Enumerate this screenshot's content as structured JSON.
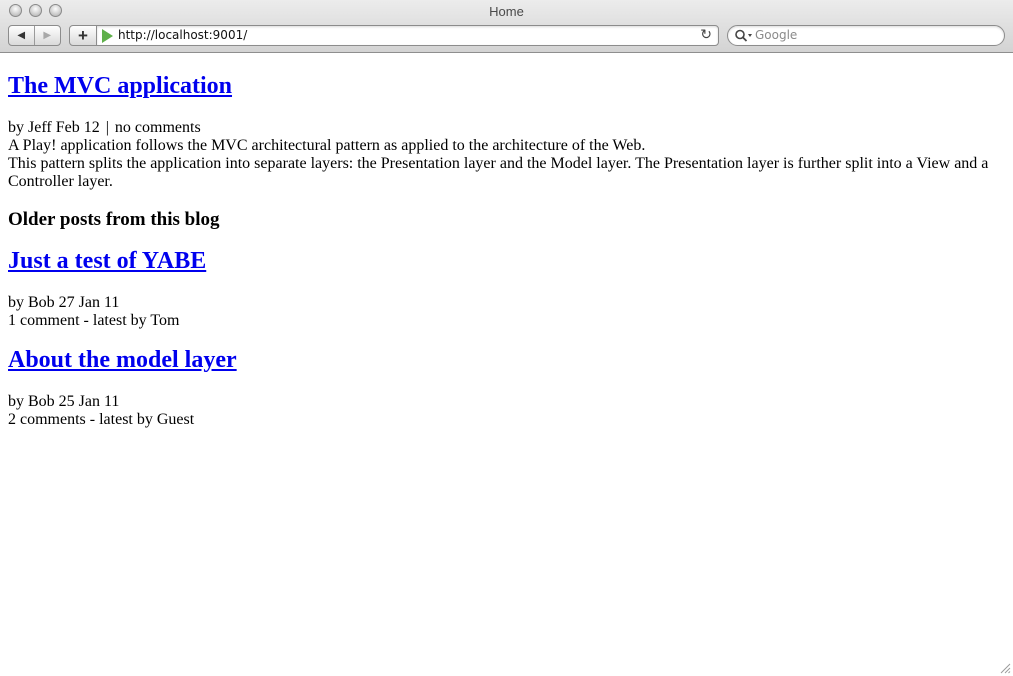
{
  "window": {
    "title": "Home"
  },
  "toolbar": {
    "add_label": "+",
    "url": "http://localhost:9001/",
    "search_placeholder": "Google"
  },
  "colors": {
    "link": "#0000ee",
    "play_icon": "#5fb04a"
  },
  "featured": {
    "title": "The MVC application",
    "meta": "by Jeff Feb 12",
    "separator": "|",
    "comments": "no comments",
    "body_line1": "A Play! application follows the MVC architectural pattern as applied to the architecture of the Web.",
    "body_line2": "This pattern splits the application into separate layers: the Presentation layer and the Model layer. The Presentation layer is further split into a View and a",
    "body_line3": "Controller layer."
  },
  "older": {
    "heading": "Older posts from this blog",
    "posts": [
      {
        "title": "Just a test of YABE",
        "meta": "by Bob 27 Jan 11",
        "comments": "1 comment - latest by Tom"
      },
      {
        "title": "About the model layer",
        "meta": "by Bob 25 Jan 11",
        "comments": "2 comments - latest by Guest"
      }
    ]
  }
}
